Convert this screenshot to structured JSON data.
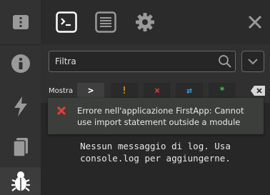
{
  "colors": {
    "error_red": "#e0403a",
    "warning_orange": "#f08a24",
    "info_blue": "#3b98e0",
    "success_green": "#3fbf4f",
    "icon_gray": "#9a9a9a",
    "text": "#e8e8e8"
  },
  "sidebar": {
    "items": [
      {
        "icon": "panel-icon"
      },
      {
        "icon": "info-icon"
      },
      {
        "icon": "lightning-icon"
      },
      {
        "icon": "document-icon"
      },
      {
        "icon": "bug-icon",
        "active": true
      }
    ]
  },
  "topbar": {
    "tabs": [
      {
        "icon": "terminal-icon",
        "active": true
      },
      {
        "icon": "list-icon"
      },
      {
        "icon": "gear-icon"
      }
    ],
    "close_icon": "close-icon"
  },
  "filter": {
    "placeholder": "Filtra",
    "value": ""
  },
  "levels": {
    "label": "Mostra",
    "buttons": [
      {
        "symbol": ">",
        "name": "log",
        "color": "#ffffff",
        "on": true
      },
      {
        "symbol": "!",
        "name": "warning",
        "color": "#f08a24",
        "on": false
      },
      {
        "symbol": "×",
        "name": "error",
        "color": "#e0403a",
        "on": false
      },
      {
        "symbol": "⇄",
        "name": "network",
        "color": "#3b98e0",
        "on": false
      },
      {
        "symbol": "*",
        "name": "success",
        "color": "#3fbf4f",
        "on": false
      }
    ]
  },
  "console": {
    "empty_line1": "Nessun messaggio di log. Usa",
    "empty_line2": "console.log per aggiungerne."
  },
  "toast": {
    "message": "Errore nell'applicazione FirstApp: Cannot use import statement outside a module"
  }
}
